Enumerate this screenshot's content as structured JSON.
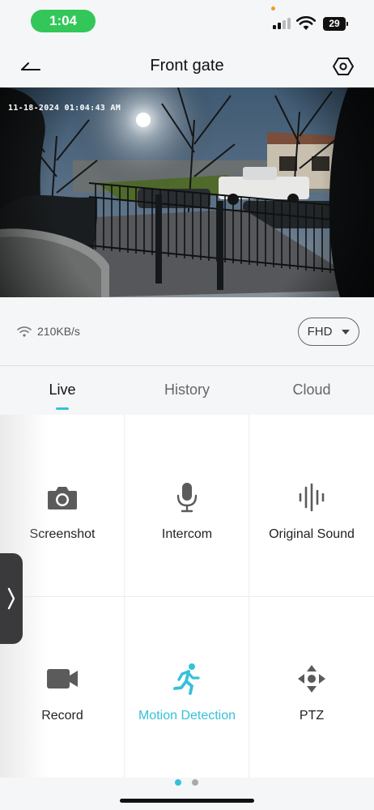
{
  "status_bar": {
    "time": "1:04",
    "battery": "29"
  },
  "header": {
    "title": "Front gate"
  },
  "video": {
    "timestamp": "11-18-2024 01:04:43 AM"
  },
  "stream": {
    "speed": "210KB/s",
    "quality": "FHD"
  },
  "tabs": [
    {
      "label": "Live"
    },
    {
      "label": "History"
    },
    {
      "label": "Cloud"
    }
  ],
  "actions": [
    {
      "label": "Screenshot",
      "icon": "camera-icon"
    },
    {
      "label": "Intercom",
      "icon": "microphone-icon"
    },
    {
      "label": "Original Sound",
      "icon": "sound-wave-icon"
    },
    {
      "label": "Record",
      "icon": "video-camera-icon"
    },
    {
      "label": "Motion Detection",
      "icon": "running-person-icon"
    },
    {
      "label": "PTZ",
      "icon": "ptz-arrows-icon"
    }
  ],
  "colors": {
    "accent": "#35c1d8",
    "time_pill": "#33c759",
    "icon_gray": "#5b5b5b"
  },
  "pager": {
    "pages": 2,
    "current": 1
  }
}
